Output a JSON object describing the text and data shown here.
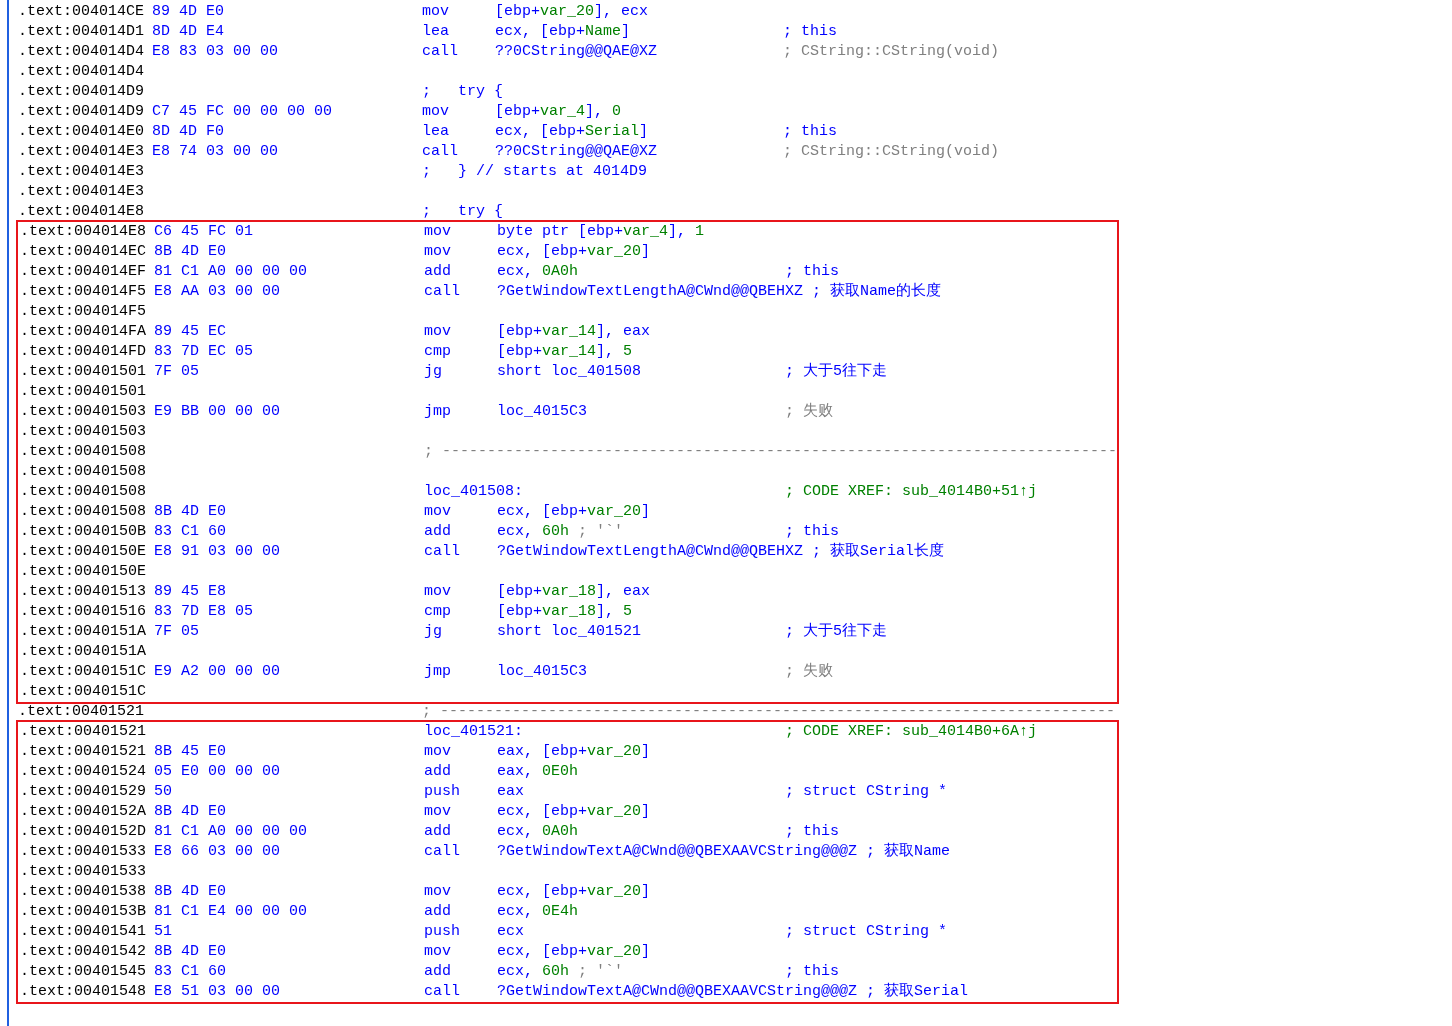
{
  "blocks": [
    {
      "highlighted": false,
      "lines": [
        {
          "address": ".text:004014CE",
          "kind": "instr",
          "bytes": "89 4D E0",
          "mnemonic": "mov",
          "operands": [
            {
              "text": "[ebp+",
              "kind": "plain"
            },
            {
              "text": "var_20",
              "kind": "name"
            },
            {
              "text": "], ecx",
              "kind": "plain"
            }
          ]
        },
        {
          "address": ".text:004014D1",
          "kind": "instr",
          "bytes": "8D 4D E4",
          "mnemonic": "lea",
          "operands": [
            {
              "text": "ecx, [ebp+",
              "kind": "plain"
            },
            {
              "text": "Name",
              "kind": "name"
            },
            {
              "text": "]",
              "kind": "plain"
            }
          ],
          "comment": {
            "text": "; this",
            "kind": "regular"
          }
        },
        {
          "address": ".text:004014D4",
          "kind": "instr",
          "bytes": "E8 83 03 00 00",
          "mnemonic": "call",
          "operands": [
            {
              "text": "??0CString@@QAE@XZ",
              "kind": "plain"
            }
          ],
          "comment": {
            "text": "; CString::CString(void)",
            "kind": "auto"
          }
        },
        {
          "address": ".text:004014D4",
          "kind": "blank"
        },
        {
          "address": ".text:004014D9",
          "kind": "note",
          "text": ";   try {"
        },
        {
          "address": ".text:004014D9",
          "kind": "instr",
          "bytes": "C7 45 FC 00 00 00 00",
          "mnemonic": "mov",
          "operands": [
            {
              "text": "[ebp+",
              "kind": "plain"
            },
            {
              "text": "var_4",
              "kind": "name"
            },
            {
              "text": "], ",
              "kind": "plain"
            },
            {
              "text": "0",
              "kind": "number"
            }
          ]
        },
        {
          "address": ".text:004014E0",
          "kind": "instr",
          "bytes": "8D 4D F0",
          "mnemonic": "lea",
          "operands": [
            {
              "text": "ecx, [ebp+",
              "kind": "plain"
            },
            {
              "text": "Serial",
              "kind": "name"
            },
            {
              "text": "]",
              "kind": "plain"
            }
          ],
          "comment": {
            "text": "; this",
            "kind": "regular"
          }
        },
        {
          "address": ".text:004014E3",
          "kind": "instr",
          "bytes": "E8 74 03 00 00",
          "mnemonic": "call",
          "operands": [
            {
              "text": "??0CString@@QAE@XZ",
              "kind": "plain"
            }
          ],
          "comment": {
            "text": "; CString::CString(void)",
            "kind": "auto"
          }
        },
        {
          "address": ".text:004014E3",
          "kind": "note",
          "text": ";   } // starts at 4014D9"
        },
        {
          "address": ".text:004014E3",
          "kind": "blank"
        },
        {
          "address": ".text:004014E8",
          "kind": "note",
          "text": ";   try {"
        }
      ]
    },
    {
      "highlighted": true,
      "lines": [
        {
          "address": ".text:004014E8",
          "kind": "instr",
          "bytes": "C6 45 FC 01",
          "mnemonic": "mov",
          "operands": [
            {
              "text": "byte ptr [ebp+",
              "kind": "plain"
            },
            {
              "text": "var_4",
              "kind": "name"
            },
            {
              "text": "], ",
              "kind": "plain"
            },
            {
              "text": "1",
              "kind": "number"
            }
          ]
        },
        {
          "address": ".text:004014EC",
          "kind": "instr",
          "bytes": "8B 4D E0",
          "mnemonic": "mov",
          "operands": [
            {
              "text": "ecx, [ebp+",
              "kind": "plain"
            },
            {
              "text": "var_20",
              "kind": "name"
            },
            {
              "text": "]",
              "kind": "plain"
            }
          ]
        },
        {
          "address": ".text:004014EF",
          "kind": "instr",
          "bytes": "81 C1 A0 00 00 00",
          "mnemonic": "add",
          "operands": [
            {
              "text": "ecx, ",
              "kind": "plain"
            },
            {
              "text": "0A0h",
              "kind": "number"
            }
          ],
          "comment": {
            "text": "; this",
            "kind": "regular"
          }
        },
        {
          "address": ".text:004014F5",
          "kind": "instr",
          "bytes": "E8 AA 03 00 00",
          "mnemonic": "call",
          "operands": [
            {
              "text": "?GetWindowTextLengthA@CWnd@@QBEHXZ ; 获取Name的长度",
              "kind": "plain"
            }
          ]
        },
        {
          "address": ".text:004014F5",
          "kind": "blank"
        },
        {
          "address": ".text:004014FA",
          "kind": "instr",
          "bytes": "89 45 EC",
          "mnemonic": "mov",
          "operands": [
            {
              "text": "[ebp+",
              "kind": "plain"
            },
            {
              "text": "var_14",
              "kind": "name"
            },
            {
              "text": "], eax",
              "kind": "plain"
            }
          ]
        },
        {
          "address": ".text:004014FD",
          "kind": "instr",
          "bytes": "83 7D EC 05",
          "mnemonic": "cmp",
          "operands": [
            {
              "text": "[ebp+",
              "kind": "plain"
            },
            {
              "text": "var_14",
              "kind": "name"
            },
            {
              "text": "], ",
              "kind": "plain"
            },
            {
              "text": "5",
              "kind": "number"
            }
          ]
        },
        {
          "address": ".text:00401501",
          "kind": "instr",
          "bytes": "7F 05",
          "mnemonic": "jg",
          "operands": [
            {
              "text": "short loc_401508",
              "kind": "plain"
            }
          ],
          "comment": {
            "text": "; 大于5往下走",
            "kind": "regular"
          }
        },
        {
          "address": ".text:00401501",
          "kind": "blank"
        },
        {
          "address": ".text:00401503",
          "kind": "instr",
          "bytes": "E9 BB 00 00 00",
          "mnemonic": "jmp",
          "operands": [
            {
              "text": "loc_4015C3",
              "kind": "plain"
            }
          ],
          "comment": {
            "text": "; 失败",
            "kind": "auto"
          }
        },
        {
          "address": ".text:00401503",
          "kind": "blank"
        },
        {
          "address": ".text:00401508",
          "kind": "separator",
          "text": "; ---------------------------------------------------------------------------"
        },
        {
          "address": ".text:00401508",
          "kind": "blank"
        },
        {
          "address": ".text:00401508",
          "kind": "note",
          "text": "loc_401508:",
          "comment": {
            "text": "; CODE XREF: sub_4014B0+51↑j",
            "kind": "xref"
          }
        },
        {
          "address": ".text:00401508",
          "kind": "instr",
          "bytes": "8B 4D E0",
          "mnemonic": "mov",
          "operands": [
            {
              "text": "ecx, [ebp+",
              "kind": "plain"
            },
            {
              "text": "var_20",
              "kind": "name"
            },
            {
              "text": "]",
              "kind": "plain"
            }
          ]
        },
        {
          "address": ".text:0040150B",
          "kind": "instr",
          "bytes": "83 C1 60",
          "mnemonic": "add",
          "operands": [
            {
              "text": "ecx, ",
              "kind": "plain"
            },
            {
              "text": "60h",
              "kind": "number"
            },
            {
              "text": " ; '`'",
              "kind": "auto"
            }
          ],
          "comment": {
            "text": "; this",
            "kind": "regular"
          }
        },
        {
          "address": ".text:0040150E",
          "kind": "instr",
          "bytes": "E8 91 03 00 00",
          "mnemonic": "call",
          "operands": [
            {
              "text": "?GetWindowTextLengthA@CWnd@@QBEHXZ ; 获取Serial长度",
              "kind": "plain"
            }
          ]
        },
        {
          "address": ".text:0040150E",
          "kind": "blank"
        },
        {
          "address": ".text:00401513",
          "kind": "instr",
          "bytes": "89 45 E8",
          "mnemonic": "mov",
          "operands": [
            {
              "text": "[ebp+",
              "kind": "plain"
            },
            {
              "text": "var_18",
              "kind": "name"
            },
            {
              "text": "], eax",
              "kind": "plain"
            }
          ]
        },
        {
          "address": ".text:00401516",
          "kind": "instr",
          "bytes": "83 7D E8 05",
          "mnemonic": "cmp",
          "operands": [
            {
              "text": "[ebp+",
              "kind": "plain"
            },
            {
              "text": "var_18",
              "kind": "name"
            },
            {
              "text": "], ",
              "kind": "plain"
            },
            {
              "text": "5",
              "kind": "number"
            }
          ]
        },
        {
          "address": ".text:0040151A",
          "kind": "instr",
          "bytes": "7F 05",
          "mnemonic": "jg",
          "operands": [
            {
              "text": "short loc_401521",
              "kind": "plain"
            }
          ],
          "comment": {
            "text": "; 大于5往下走",
            "kind": "regular"
          }
        },
        {
          "address": ".text:0040151A",
          "kind": "blank"
        },
        {
          "address": ".text:0040151C",
          "kind": "instr",
          "bytes": "E9 A2 00 00 00",
          "mnemonic": "jmp",
          "operands": [
            {
              "text": "loc_4015C3",
              "kind": "plain"
            }
          ],
          "comment": {
            "text": "; 失败",
            "kind": "auto"
          }
        },
        {
          "address": ".text:0040151C",
          "kind": "blank"
        }
      ]
    },
    {
      "highlighted": false,
      "lines": [
        {
          "address": ".text:00401521",
          "kind": "separator",
          "text": "; ---------------------------------------------------------------------------"
        }
      ]
    },
    {
      "highlighted": true,
      "lines": [
        {
          "address": ".text:00401521",
          "kind": "note",
          "text": "loc_401521:",
          "comment": {
            "text": "; CODE XREF: sub_4014B0+6A↑j",
            "kind": "xref"
          }
        },
        {
          "address": ".text:00401521",
          "kind": "instr",
          "bytes": "8B 45 E0",
          "mnemonic": "mov",
          "operands": [
            {
              "text": "eax, [ebp+",
              "kind": "plain"
            },
            {
              "text": "var_20",
              "kind": "name"
            },
            {
              "text": "]",
              "kind": "plain"
            }
          ]
        },
        {
          "address": ".text:00401524",
          "kind": "instr",
          "bytes": "05 E0 00 00 00",
          "mnemonic": "add",
          "operands": [
            {
              "text": "eax, ",
              "kind": "plain"
            },
            {
              "text": "0E0h",
              "kind": "number"
            }
          ]
        },
        {
          "address": ".text:00401529",
          "kind": "instr",
          "bytes": "50",
          "mnemonic": "push",
          "operands": [
            {
              "text": "eax",
              "kind": "plain"
            }
          ],
          "comment": {
            "text": "; struct CString *",
            "kind": "regular"
          }
        },
        {
          "address": ".text:0040152A",
          "kind": "instr",
          "bytes": "8B 4D E0",
          "mnemonic": "mov",
          "operands": [
            {
              "text": "ecx, [ebp+",
              "kind": "plain"
            },
            {
              "text": "var_20",
              "kind": "name"
            },
            {
              "text": "]",
              "kind": "plain"
            }
          ]
        },
        {
          "address": ".text:0040152D",
          "kind": "instr",
          "bytes": "81 C1 A0 00 00 00",
          "mnemonic": "add",
          "operands": [
            {
              "text": "ecx, ",
              "kind": "plain"
            },
            {
              "text": "0A0h",
              "kind": "number"
            }
          ],
          "comment": {
            "text": "; this",
            "kind": "regular"
          }
        },
        {
          "address": ".text:00401533",
          "kind": "instr",
          "bytes": "E8 66 03 00 00",
          "mnemonic": "call",
          "operands": [
            {
              "text": "?GetWindowTextA@CWnd@@QBEXAAVCString@@@Z ; 获取Name",
              "kind": "plain"
            }
          ]
        },
        {
          "address": ".text:00401533",
          "kind": "blank"
        },
        {
          "address": ".text:00401538",
          "kind": "instr",
          "bytes": "8B 4D E0",
          "mnemonic": "mov",
          "operands": [
            {
              "text": "ecx, [ebp+",
              "kind": "plain"
            },
            {
              "text": "var_20",
              "kind": "name"
            },
            {
              "text": "]",
              "kind": "plain"
            }
          ]
        },
        {
          "address": ".text:0040153B",
          "kind": "instr",
          "bytes": "81 C1 E4 00 00 00",
          "mnemonic": "add",
          "operands": [
            {
              "text": "ecx, ",
              "kind": "plain"
            },
            {
              "text": "0E4h",
              "kind": "number"
            }
          ]
        },
        {
          "address": ".text:00401541",
          "kind": "instr",
          "bytes": "51",
          "mnemonic": "push",
          "operands": [
            {
              "text": "ecx",
              "kind": "plain"
            }
          ],
          "comment": {
            "text": "; struct CString *",
            "kind": "regular"
          }
        },
        {
          "address": ".text:00401542",
          "kind": "instr",
          "bytes": "8B 4D E0",
          "mnemonic": "mov",
          "operands": [
            {
              "text": "ecx, [ebp+",
              "kind": "plain"
            },
            {
              "text": "var_20",
              "kind": "name"
            },
            {
              "text": "]",
              "kind": "plain"
            }
          ]
        },
        {
          "address": ".text:00401545",
          "kind": "instr",
          "bytes": "83 C1 60",
          "mnemonic": "add",
          "operands": [
            {
              "text": "ecx, ",
              "kind": "plain"
            },
            {
              "text": "60h",
              "kind": "number"
            },
            {
              "text": " ; '`'",
              "kind": "auto"
            }
          ],
          "comment": {
            "text": "; this",
            "kind": "regular"
          }
        },
        {
          "address": ".text:00401548",
          "kind": "instr",
          "bytes": "E8 51 03 00 00",
          "mnemonic": "call",
          "operands": [
            {
              "text": "?GetWindowTextA@CWnd@@QBEXAAVCString@@@Z ; 获取Serial",
              "kind": "plain"
            }
          ]
        }
      ]
    }
  ]
}
